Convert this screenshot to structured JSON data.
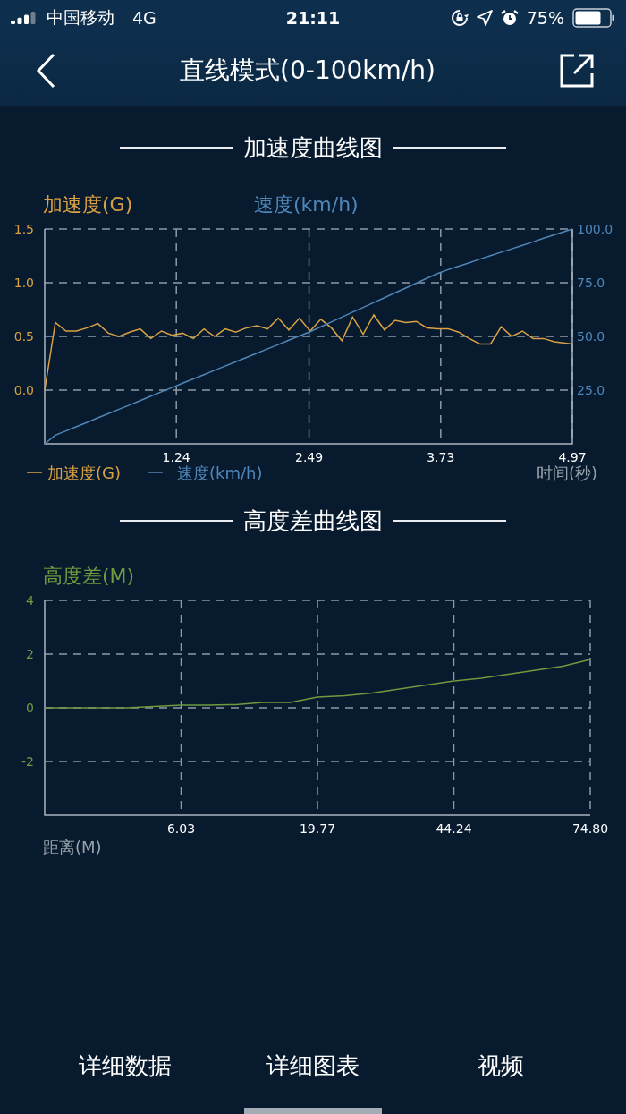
{
  "status_bar": {
    "carrier": "中国移动",
    "network": "4G",
    "time": "21:11",
    "battery": "75%"
  },
  "nav": {
    "title": "直线模式(0-100km/h)"
  },
  "sections": [
    {
      "title": "加速度曲线图",
      "speed_heading": "速度(km/h)",
      "chart_data": {
        "type": "line",
        "xlabel": "时间(秒)",
        "ylabel": "加速度(G)",
        "legend": true,
        "x": [
          0,
          0.1,
          0.2,
          0.3,
          0.4,
          0.5,
          0.6,
          0.7,
          0.8,
          0.9,
          1.0,
          1.1,
          1.2,
          1.3,
          1.4,
          1.5,
          1.6,
          1.7,
          1.8,
          1.9,
          2.0,
          2.1,
          2.2,
          2.3,
          2.4,
          2.5,
          2.6,
          2.7,
          2.8,
          2.9,
          3.0,
          3.1,
          3.2,
          3.3,
          3.4,
          3.5,
          3.6,
          3.7,
          3.8,
          3.9,
          4.0,
          4.1,
          4.2,
          4.3,
          4.4,
          4.5,
          4.6,
          4.7,
          4.8,
          4.97
        ],
        "series": [
          {
            "name": "加速度(G)",
            "color": "#d9a144",
            "values": [
              0,
              0.63,
              0.55,
              0.55,
              0.58,
              0.62,
              0.53,
              0.5,
              0.54,
              0.57,
              0.48,
              0.55,
              0.51,
              0.53,
              0.48,
              0.57,
              0.5,
              0.57,
              0.54,
              0.58,
              0.6,
              0.57,
              0.67,
              0.56,
              0.67,
              0.55,
              0.66,
              0.58,
              0.46,
              0.68,
              0.52,
              0.7,
              0.56,
              0.65,
              0.63,
              0.64,
              0.58,
              0.57,
              0.57,
              0.54,
              0.48,
              0.43,
              0.43,
              0.59,
              0.5,
              0.55,
              0.48,
              0.48,
              0.45,
              0.43
            ]
          },
          {
            "name": "速度(km/h)",
            "color": "#4f86b8",
            "axis": "y2",
            "values": [
              0,
              4,
              6,
              8.0,
              10.0,
              12.1,
              14.1,
              16.1,
              18.1,
              20.1,
              22.2,
              24.2,
              26.2,
              28.2,
              30.2,
              32.2,
              34.2,
              36.2,
              38.2,
              40.2,
              42.2,
              44.2,
              46.2,
              48.2,
              50.2,
              52.2,
              54.5,
              56.7,
              59.0,
              61.3,
              63.5,
              65.8,
              68.0,
              70.3,
              72.5,
              74.8,
              77.1,
              79.3,
              81.1,
              82.7,
              84.3,
              86.0,
              87.6,
              89.2,
              90.8,
              92.4,
              94.0,
              95.7,
              97.3,
              100
            ]
          }
        ],
        "xlim": [
          0,
          4.97
        ],
        "ylim": [
          -0.5,
          1.5
        ],
        "y2lim": [
          0,
          100
        ],
        "grid": true,
        "xticks": [
          1.24,
          2.49,
          3.73,
          4.97
        ],
        "yticks": [
          {
            "value": 1.5,
            "label": "1.5"
          },
          {
            "value": 1.0,
            "label": "1.0"
          },
          {
            "value": 0.5,
            "label": "0.5"
          },
          {
            "value": 0,
            "label": "0.0"
          }
        ],
        "y2ticks": [
          {
            "value": 100,
            "label": "100.0"
          },
          {
            "value": 75,
            "label": "75.0"
          },
          {
            "value": 50,
            "label": "50.0"
          },
          {
            "value": 25,
            "label": "25.0"
          }
        ]
      }
    },
    {
      "title": "高度差曲线图",
      "chart_data": {
        "type": "line",
        "xlabel": "距离(M)",
        "ylabel": "高度差(M)",
        "legend": false,
        "categories": [
          null,
          null,
          null,
          null,
          null,
          "6.03",
          null,
          null,
          null,
          null,
          "19.77",
          null,
          null,
          null,
          null,
          "44.24",
          null,
          null,
          null,
          null,
          "74.80"
        ],
        "series": [
          {
            "color": "#6f9a3e",
            "values": [
              0,
              0,
              0,
              0,
              0.05,
              0.1,
              0.1,
              0.12,
              0.2,
              0.2,
              0.4,
              0.45,
              0.55,
              0.7,
              0.85,
              1.0,
              1.1,
              1.25,
              1.4,
              1.55,
              1.8
            ]
          }
        ],
        "ylim": [
          -4,
          4
        ],
        "grid": true,
        "yticks": [
          4,
          2,
          0,
          -2
        ]
      }
    }
  ],
  "tabs": [
    {
      "label": "详细数据",
      "selected": false
    },
    {
      "label": "详细图表",
      "selected": true
    },
    {
      "label": "视频",
      "selected": false
    }
  ]
}
